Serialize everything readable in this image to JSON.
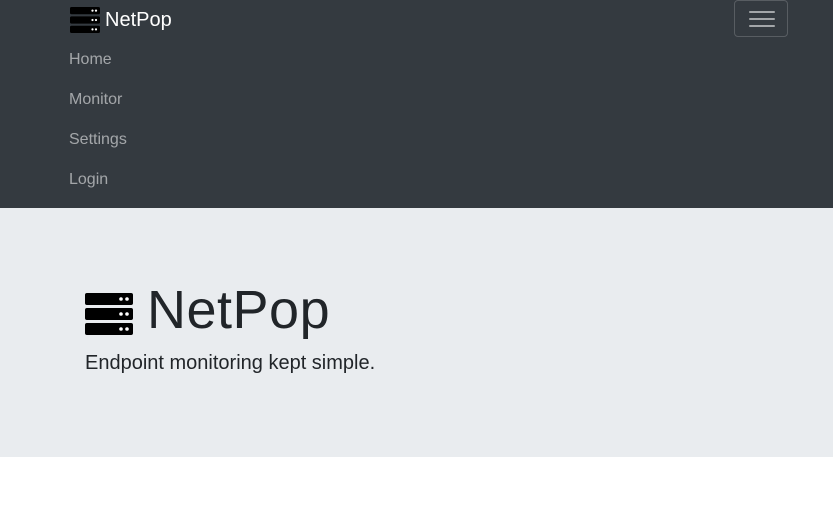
{
  "navbar": {
    "brand": {
      "icon": "server-icon",
      "label": "NetPop"
    },
    "toggler": {
      "icon": "hamburger-menu-icon"
    },
    "items": [
      {
        "label": "Home"
      },
      {
        "label": "Monitor"
      },
      {
        "label": "Settings"
      },
      {
        "label": "Login"
      }
    ]
  },
  "hero": {
    "icon": "server-icon",
    "title": "NetPop",
    "lead": "Endpoint monitoring kept simple."
  },
  "colors": {
    "navbar_bg": "#343a40",
    "jumbotron_bg": "#e9ecef",
    "page_bg": "#ffffff",
    "nav_link": "rgba(255,255,255,0.55)",
    "text": "#212529"
  }
}
